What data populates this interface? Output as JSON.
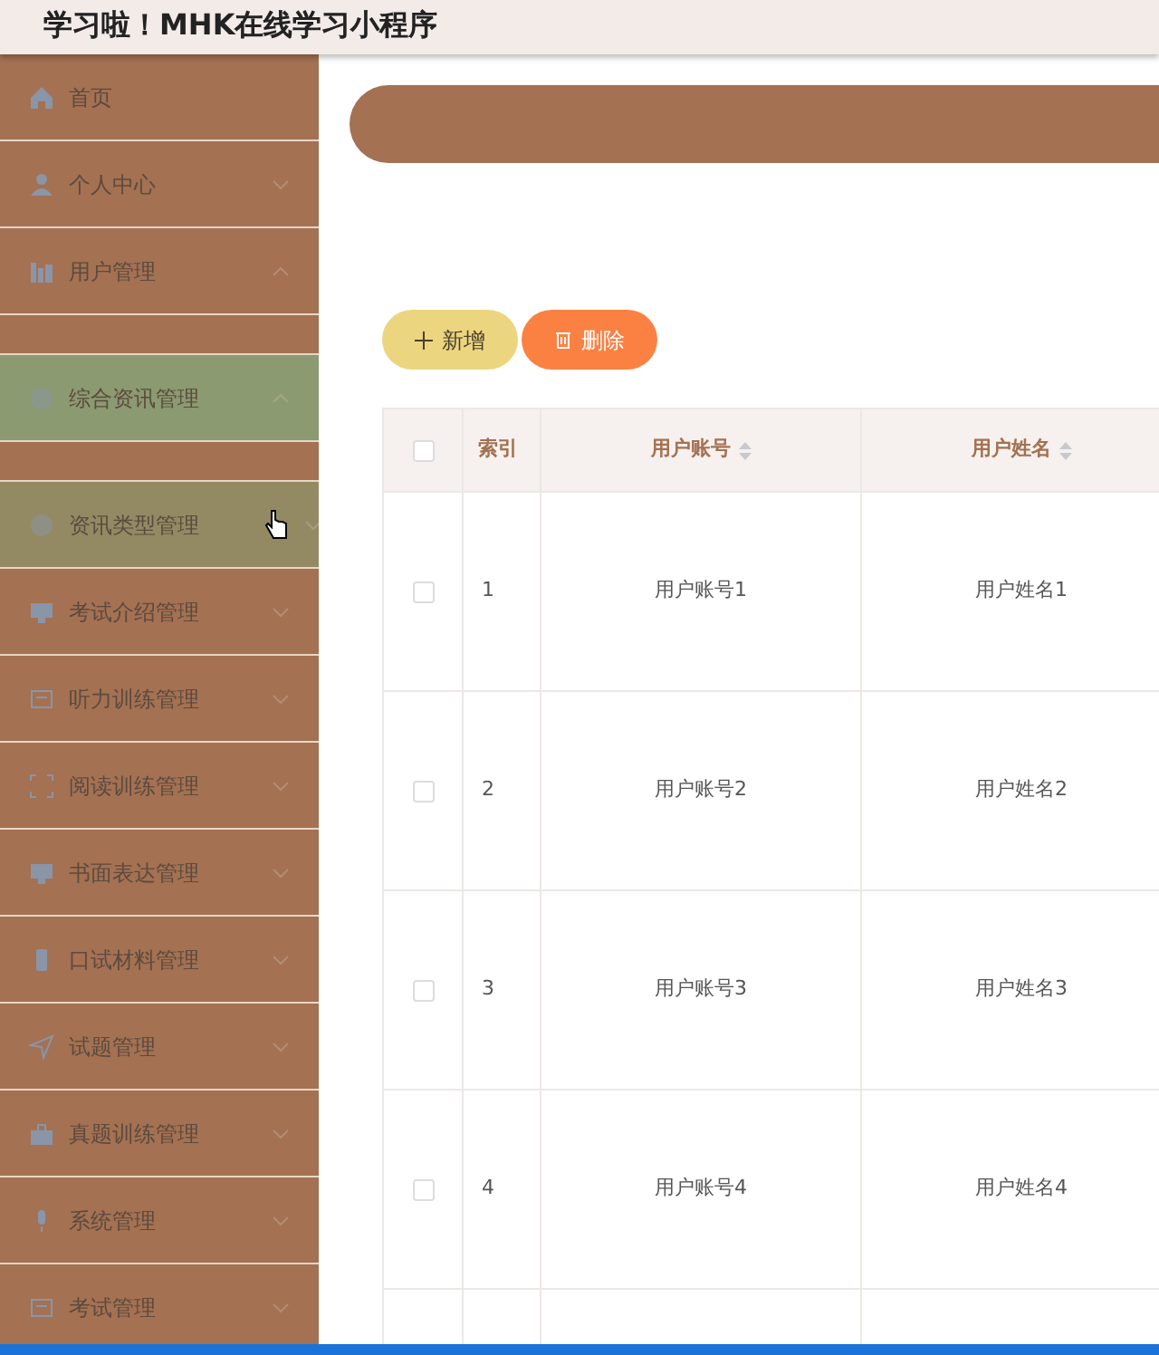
{
  "window": {
    "title": "学习啦！MHK在线学习小程序"
  },
  "sidebar": {
    "items": [
      {
        "label": "首页",
        "expandable": false,
        "selected": false,
        "hovered": false
      },
      {
        "label": "个人中心",
        "expandable": true,
        "expanded": false,
        "selected": false,
        "hovered": false
      },
      {
        "label": "用户管理",
        "expandable": true,
        "expanded": true,
        "selected": false,
        "hovered": false
      },
      {
        "label": "综合资讯管理",
        "expandable": true,
        "expanded": true,
        "selected": true,
        "hovered": false
      },
      {
        "label": "资讯类型管理",
        "expandable": true,
        "expanded": false,
        "selected": false,
        "hovered": true
      },
      {
        "label": "考试介绍管理",
        "expandable": true,
        "expanded": false,
        "selected": false,
        "hovered": false
      },
      {
        "label": "听力训练管理",
        "expandable": true,
        "expanded": false,
        "selected": false,
        "hovered": false
      },
      {
        "label": "阅读训练管理",
        "expandable": true,
        "expanded": false,
        "selected": false,
        "hovered": false
      },
      {
        "label": "书面表达管理",
        "expandable": true,
        "expanded": false,
        "selected": false,
        "hovered": false
      },
      {
        "label": "口试材料管理",
        "expandable": true,
        "expanded": false,
        "selected": false,
        "hovered": false
      },
      {
        "label": "试题管理",
        "expandable": true,
        "expanded": false,
        "selected": false,
        "hovered": false
      },
      {
        "label": "真题训练管理",
        "expandable": true,
        "expanded": false,
        "selected": false,
        "hovered": false
      },
      {
        "label": "系统管理",
        "expandable": true,
        "expanded": false,
        "selected": false,
        "hovered": false
      },
      {
        "label": "考试管理",
        "expandable": true,
        "expanded": false,
        "selected": false,
        "hovered": false
      }
    ]
  },
  "toolbar": {
    "buttons": [
      {
        "label": "新增",
        "kind": "add"
      },
      {
        "label": "删除",
        "kind": "delete"
      }
    ]
  },
  "table": {
    "all_checked": false,
    "columns": [
      {
        "label": "索引",
        "sortable": false
      },
      {
        "label": "用户账号",
        "sortable": true
      },
      {
        "label": "用户姓名",
        "sortable": true
      }
    ],
    "rows": [
      {
        "checked": false,
        "cells": [
          "1",
          "用户账号1",
          "用户姓名1"
        ]
      },
      {
        "checked": false,
        "cells": [
          "2",
          "用户账号2",
          "用户姓名2"
        ]
      },
      {
        "checked": false,
        "cells": [
          "3",
          "用户账号3",
          "用户姓名3"
        ]
      },
      {
        "checked": false,
        "cells": [
          "4",
          "用户账号4",
          "用户姓名4"
        ]
      }
    ]
  }
}
